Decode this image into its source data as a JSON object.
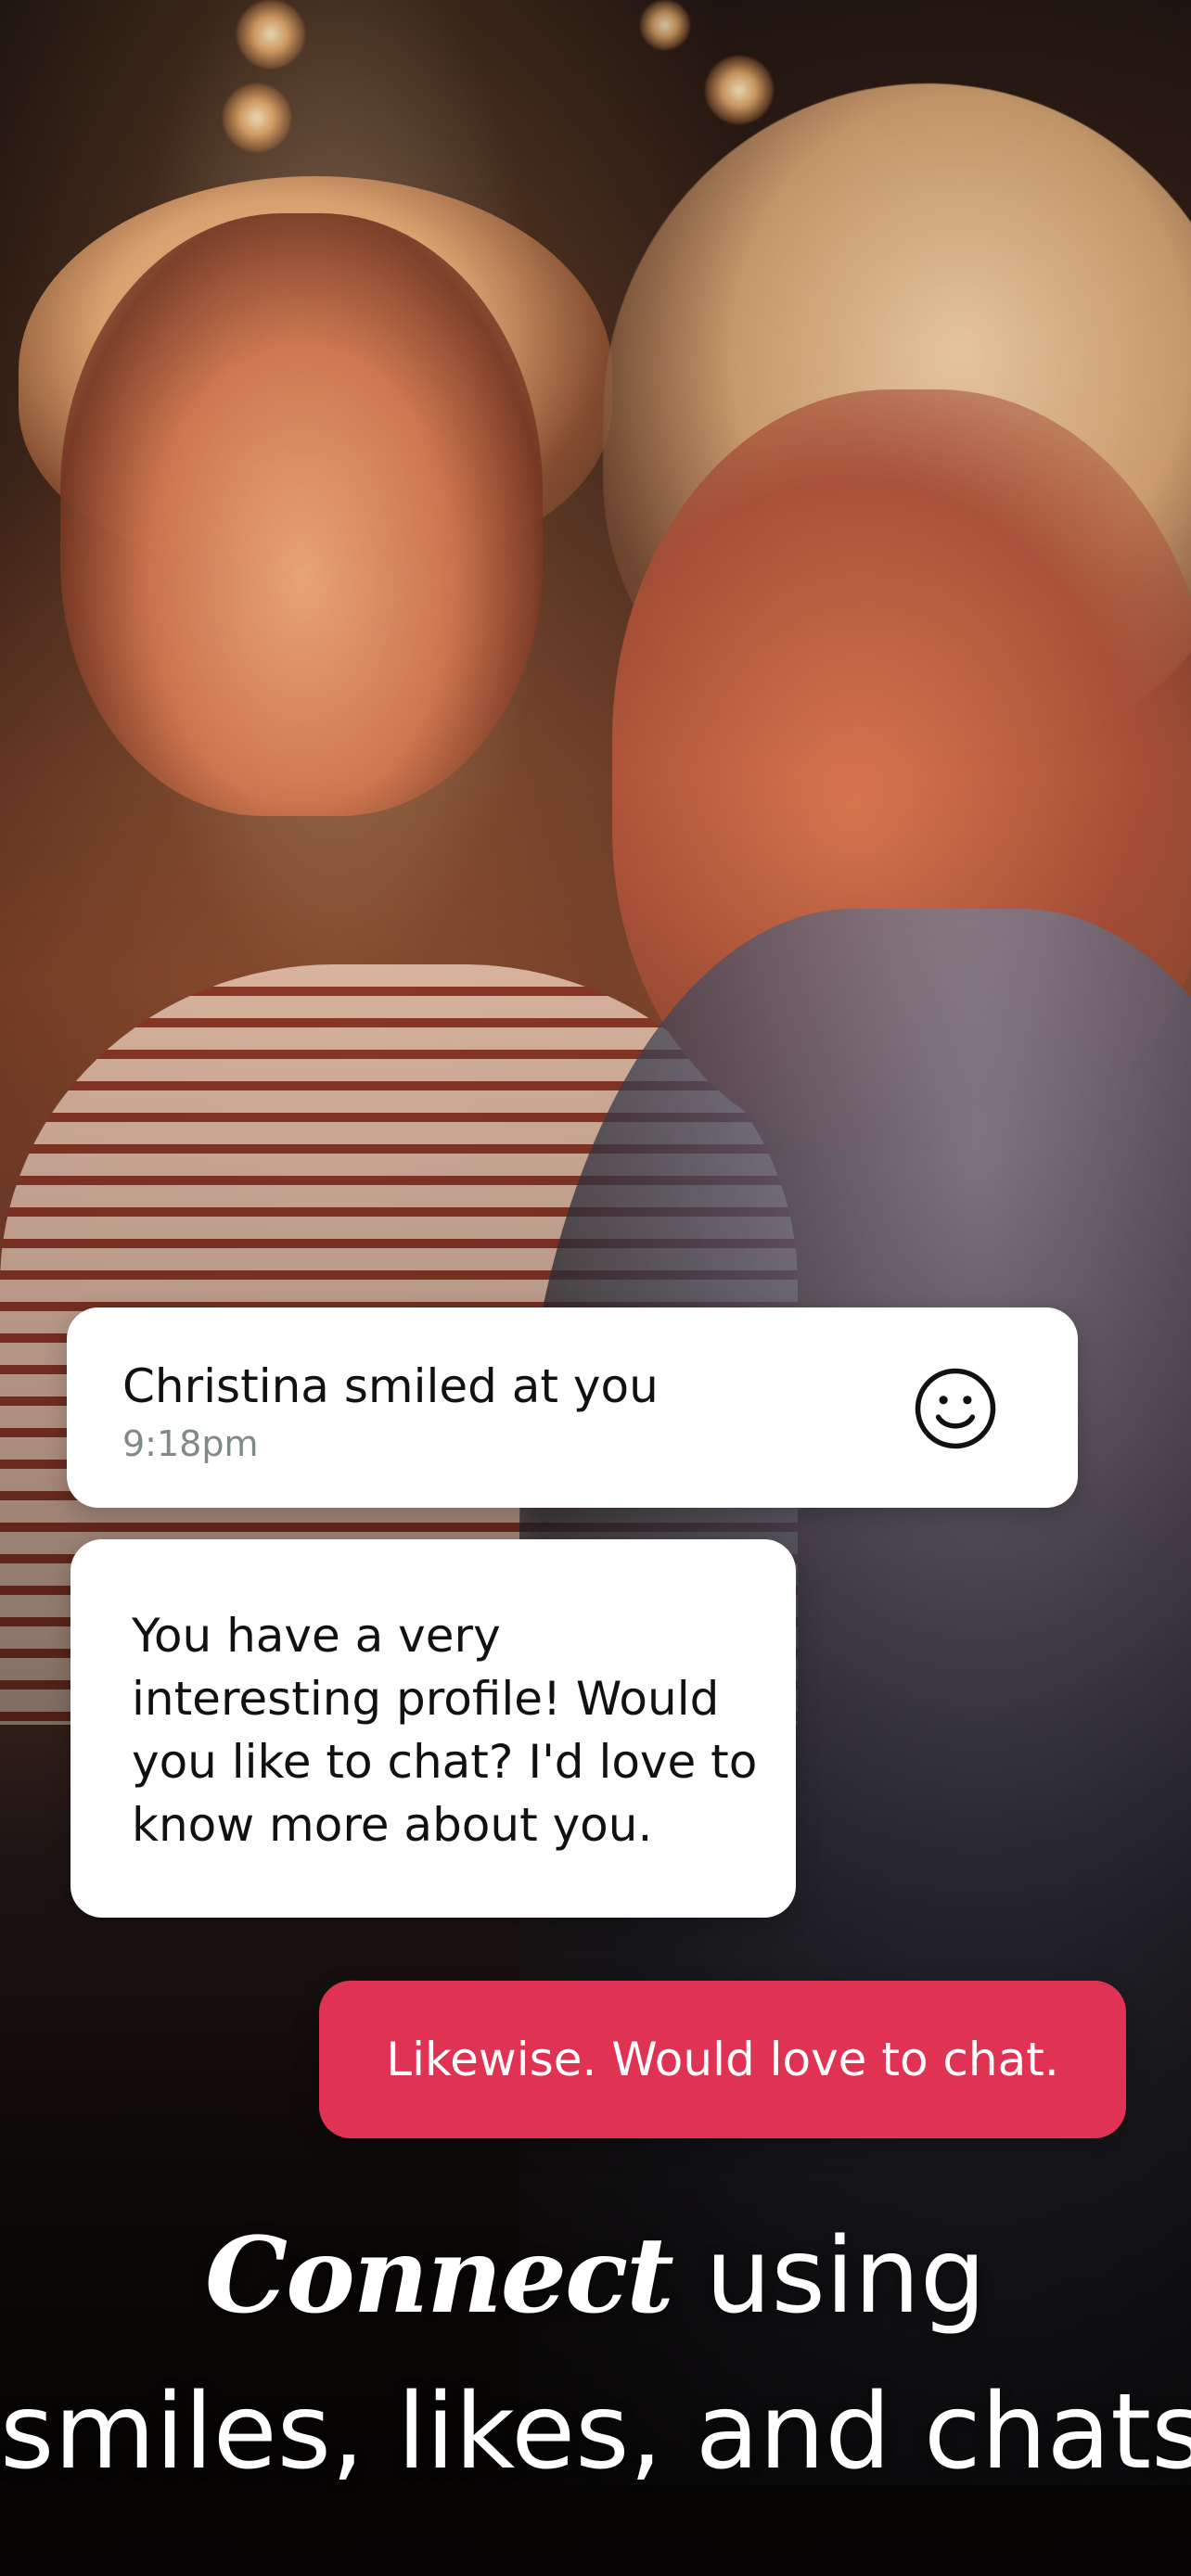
{
  "notification": {
    "text": "Christina smiled at you",
    "time": "9:18pm",
    "icon": "smiley-face-icon"
  },
  "incoming_message": {
    "text": "You have a very interesting profile! Would you like to chat? I'd love to know more about you."
  },
  "outgoing_message": {
    "text": "Likewise. Would love to chat."
  },
  "headline": {
    "accent_word": "Connect",
    "line1_rest": " using",
    "line2": "smiles, likes, and chats"
  },
  "colors": {
    "accent_pink": "#e03354",
    "time_gray": "#7f8a88",
    "card_white": "#ffffff"
  }
}
